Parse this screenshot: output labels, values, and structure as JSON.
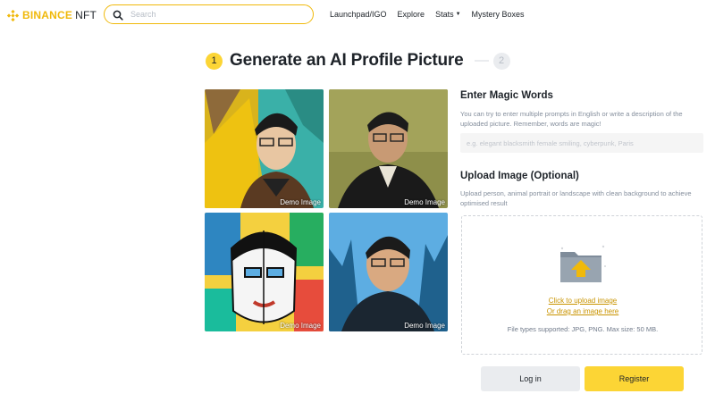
{
  "header": {
    "logo_brand": "BINANCE",
    "logo_suffix": "NFT",
    "search_placeholder": "Search",
    "nav": [
      {
        "label": "Launchpad/IGO"
      },
      {
        "label": "Explore"
      },
      {
        "label": "Stats",
        "has_dropdown": true
      },
      {
        "label": "Mystery Boxes"
      }
    ]
  },
  "steps": {
    "current": "1",
    "next": "2",
    "title": "Generate an AI Profile Picture"
  },
  "demos": [
    {
      "label": "Demo Image"
    },
    {
      "label": "Demo Image"
    },
    {
      "label": "Demo Image"
    },
    {
      "label": "Demo Image"
    }
  ],
  "magic": {
    "title": "Enter Magic Words",
    "hint": "You can try to enter multiple prompts in English or write a description of the uploaded picture. Remember, words are magic!",
    "placeholder": "e.g. elegant blacksmith female smiling, cyberpunk, Paris"
  },
  "upload": {
    "title": "Upload Image (Optional)",
    "hint": "Upload person, animal portrait or landscape with clean background to achieve optimised result",
    "click_link": "Click to upload image",
    "drag_link": "Or drag an image here",
    "file_types": "File types supported: JPG, PNG. Max size: 50 MB."
  },
  "actions": {
    "login": "Log in",
    "register": "Register"
  },
  "colors": {
    "brand_yellow": "#f0b90b",
    "button_yellow": "#fcd535",
    "link_gold": "#c99400"
  }
}
